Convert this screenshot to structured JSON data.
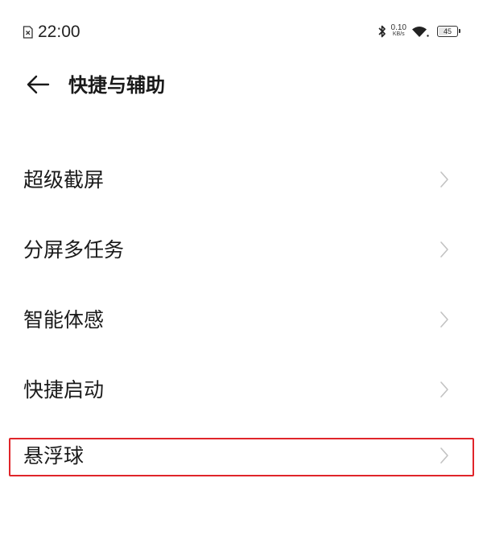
{
  "status_bar": {
    "time": "22:00",
    "net_speed_value": "0.10",
    "net_speed_unit": "KB/s",
    "battery_level": "45",
    "icons": [
      "sim-icon",
      "bluetooth-icon",
      "wifi-icon",
      "battery-icon"
    ]
  },
  "header": {
    "title": "快捷与辅助",
    "back_icon": "back-arrow-icon"
  },
  "settings": {
    "items": [
      {
        "label": "超级截屏",
        "highlighted": false
      },
      {
        "label": "分屏多任务",
        "highlighted": false
      },
      {
        "label": "智能体感",
        "highlighted": false
      },
      {
        "label": "快捷启动",
        "highlighted": false
      },
      {
        "label": "悬浮球",
        "highlighted": true
      }
    ],
    "chevron_icon": "chevron-right-icon"
  },
  "colors": {
    "background": "#ffffff",
    "text": "#1a1a1a",
    "chevron": "#c2c2c2",
    "highlight_border": "#e0252a"
  }
}
